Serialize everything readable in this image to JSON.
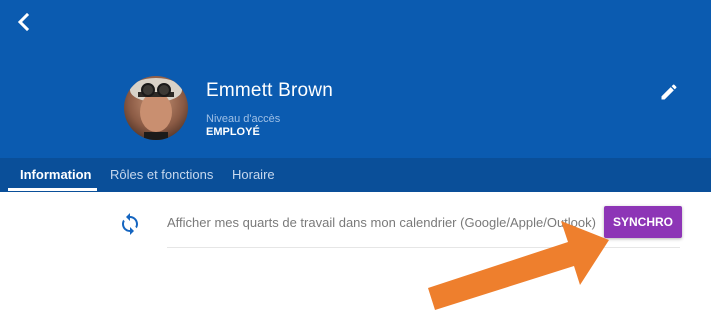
{
  "colors": {
    "header_bg": "#0b5bb0",
    "tabbar_bg": "#0a4f99",
    "accent_purple": "#8d35b6",
    "sync_icon": "#1565c0",
    "annotation_arrow": "#ee7f2d"
  },
  "header": {
    "back_icon": "chevron-left-icon",
    "edit_icon": "pencil-icon",
    "user_name": "Emmett Brown",
    "access_label": "Niveau d'accès",
    "access_value": "EMPLOYÉ"
  },
  "tabs": [
    {
      "label": "Information",
      "active": true
    },
    {
      "label": "Rôles et fonctions",
      "active": false
    },
    {
      "label": "Horaire",
      "active": false
    }
  ],
  "sync": {
    "icon": "sync-icon",
    "text": "Afficher mes quarts de travail dans mon calendrier (Google/Apple/Outlook)",
    "button_label": "SYNCHRO"
  }
}
